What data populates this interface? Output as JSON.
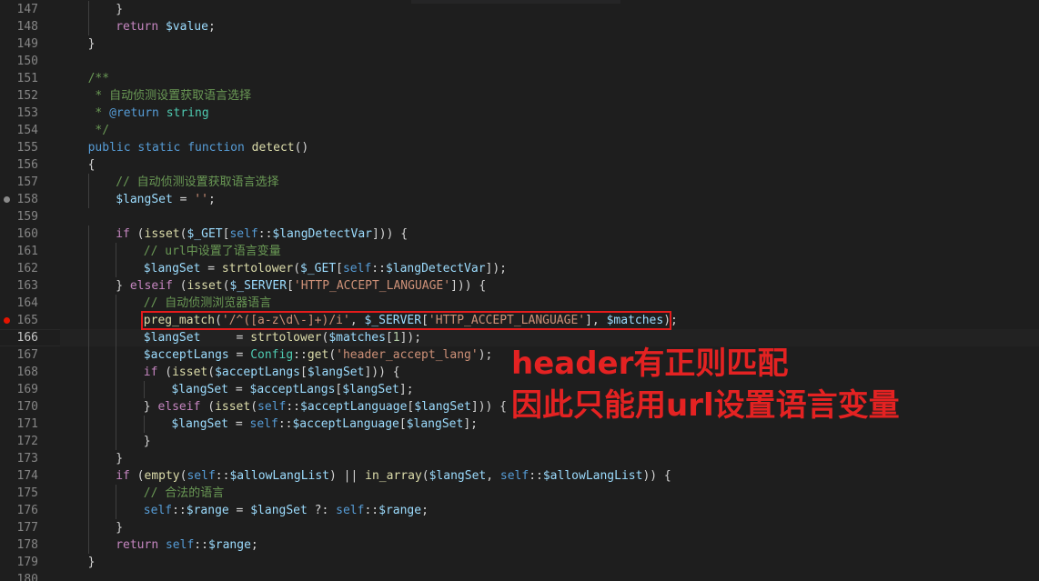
{
  "colors": {
    "background": "#1e1e1e",
    "keyword": "#569cd6",
    "control": "#c586c0",
    "function": "#dcdcaa",
    "variable": "#9cdcfe",
    "string": "#ce9178",
    "comment": "#6a9955",
    "class": "#4ec9b0",
    "text": "#d4d4d4",
    "annotation": "#e42222"
  },
  "editor": {
    "lines": [
      {
        "num": "147",
        "indent": 2,
        "tokens": [
          [
            "}",
            "p"
          ]
        ]
      },
      {
        "num": "148",
        "indent": 2,
        "tokens": [
          [
            "return",
            "c"
          ],
          [
            " ",
            "p"
          ],
          [
            "$value",
            "v"
          ],
          [
            ";",
            "p"
          ]
        ]
      },
      {
        "num": "149",
        "indent": 1,
        "tokens": [
          [
            "}",
            "p"
          ]
        ]
      },
      {
        "num": "150",
        "indent": 0,
        "tokens": []
      },
      {
        "num": "151",
        "indent": 1,
        "tokens": [
          [
            "/**",
            "cm"
          ]
        ]
      },
      {
        "num": "152",
        "indent": 1,
        "tokens": [
          [
            " * 自动侦测设置获取语言选择",
            "cm"
          ]
        ]
      },
      {
        "num": "153",
        "indent": 1,
        "tokens": [
          [
            " * ",
            "cm"
          ],
          [
            "@return",
            "k"
          ],
          [
            " ",
            "cm"
          ],
          [
            "string",
            "ty"
          ]
        ]
      },
      {
        "num": "154",
        "indent": 1,
        "tokens": [
          [
            " */",
            "cm"
          ]
        ]
      },
      {
        "num": "155",
        "indent": 1,
        "tokens": [
          [
            "public",
            "k"
          ],
          [
            " ",
            "p"
          ],
          [
            "static",
            "k"
          ],
          [
            " ",
            "p"
          ],
          [
            "function",
            "k"
          ],
          [
            " ",
            "p"
          ],
          [
            "detect",
            "f"
          ],
          [
            "()",
            "p"
          ]
        ]
      },
      {
        "num": "156",
        "indent": 1,
        "tokens": [
          [
            "{",
            "p"
          ]
        ]
      },
      {
        "num": "157",
        "indent": 2,
        "tokens": [
          [
            "// 自动侦测设置获取语言选择",
            "cm"
          ]
        ]
      },
      {
        "num": "158",
        "indent": 2,
        "bp": "gray",
        "tokens": [
          [
            "$langSet",
            "v"
          ],
          [
            " = ",
            "p"
          ],
          [
            "''",
            "s"
          ],
          [
            ";",
            "p"
          ]
        ]
      },
      {
        "num": "159",
        "indent": 0,
        "tokens": []
      },
      {
        "num": "160",
        "indent": 2,
        "tokens": [
          [
            "if",
            "c"
          ],
          [
            " (",
            "p"
          ],
          [
            "isset",
            "f"
          ],
          [
            "(",
            "p"
          ],
          [
            "$_GET",
            "v"
          ],
          [
            "[",
            "p"
          ],
          [
            "self",
            "k"
          ],
          [
            "::",
            "p"
          ],
          [
            "$langDetectVar",
            "v"
          ],
          [
            "])) {",
            "p"
          ]
        ]
      },
      {
        "num": "161",
        "indent": 3,
        "tokens": [
          [
            "// url中设置了语言变量",
            "cm"
          ]
        ]
      },
      {
        "num": "162",
        "indent": 3,
        "tokens": [
          [
            "$langSet",
            "v"
          ],
          [
            " = ",
            "p"
          ],
          [
            "strtolower",
            "f"
          ],
          [
            "(",
            "p"
          ],
          [
            "$_GET",
            "v"
          ],
          [
            "[",
            "p"
          ],
          [
            "self",
            "k"
          ],
          [
            "::",
            "p"
          ],
          [
            "$langDetectVar",
            "v"
          ],
          [
            "]);",
            "p"
          ]
        ]
      },
      {
        "num": "163",
        "indent": 2,
        "tokens": [
          [
            "} ",
            "p"
          ],
          [
            "elseif",
            "c"
          ],
          [
            " (",
            "p"
          ],
          [
            "isset",
            "f"
          ],
          [
            "(",
            "p"
          ],
          [
            "$_SERVER",
            "v"
          ],
          [
            "[",
            "p"
          ],
          [
            "'HTTP_ACCEPT_LANGUAGE'",
            "s"
          ],
          [
            "])) {",
            "p"
          ]
        ]
      },
      {
        "num": "164",
        "indent": 3,
        "tokens": [
          [
            "// 自动侦测浏览器语言",
            "cm"
          ]
        ]
      },
      {
        "num": "165",
        "indent": 3,
        "bp": "red",
        "tokens": [
          [
            "preg_match",
            "f"
          ],
          [
            "(",
            "p"
          ],
          [
            "'/^(",
            "s"
          ],
          [
            "[a-z\\d\\-]",
            "s"
          ],
          [
            "+)/i'",
            "s"
          ],
          [
            ", ",
            "p"
          ],
          [
            "$_SERVER",
            "v"
          ],
          [
            "[",
            "p"
          ],
          [
            "'HTTP_ACCEPT_LANGUAGE'",
            "s"
          ],
          [
            "], ",
            "p"
          ],
          [
            "$matches",
            "v"
          ],
          [
            ");",
            "p"
          ]
        ]
      },
      {
        "num": "166",
        "indent": 3,
        "current": true,
        "tokens": [
          [
            "$langSet",
            "v"
          ],
          [
            "     = ",
            "p"
          ],
          [
            "strtolower",
            "f"
          ],
          [
            "(",
            "p"
          ],
          [
            "$matches",
            "v"
          ],
          [
            "[",
            "p"
          ],
          [
            "1",
            "n"
          ],
          [
            "]);",
            "p"
          ]
        ]
      },
      {
        "num": "167",
        "indent": 3,
        "tokens": [
          [
            "$acceptLangs",
            "v"
          ],
          [
            " = ",
            "p"
          ],
          [
            "Config",
            "t"
          ],
          [
            "::",
            "p"
          ],
          [
            "get",
            "f"
          ],
          [
            "(",
            "p"
          ],
          [
            "'header_accept_lang'",
            "s"
          ],
          [
            ");",
            "p"
          ]
        ]
      },
      {
        "num": "168",
        "indent": 3,
        "tokens": [
          [
            "if",
            "c"
          ],
          [
            " (",
            "p"
          ],
          [
            "isset",
            "f"
          ],
          [
            "(",
            "p"
          ],
          [
            "$acceptLangs",
            "v"
          ],
          [
            "[",
            "p"
          ],
          [
            "$langSet",
            "v"
          ],
          [
            "])) {",
            "p"
          ]
        ]
      },
      {
        "num": "169",
        "indent": 4,
        "tokens": [
          [
            "$langSet",
            "v"
          ],
          [
            " = ",
            "p"
          ],
          [
            "$acceptLangs",
            "v"
          ],
          [
            "[",
            "p"
          ],
          [
            "$langSet",
            "v"
          ],
          [
            "];",
            "p"
          ]
        ]
      },
      {
        "num": "170",
        "indent": 3,
        "tokens": [
          [
            "} ",
            "p"
          ],
          [
            "elseif",
            "c"
          ],
          [
            " (",
            "p"
          ],
          [
            "isset",
            "f"
          ],
          [
            "(",
            "p"
          ],
          [
            "self",
            "k"
          ],
          [
            "::",
            "p"
          ],
          [
            "$acceptLanguage",
            "v"
          ],
          [
            "[",
            "p"
          ],
          [
            "$langSet",
            "v"
          ],
          [
            "])) {",
            "p"
          ]
        ]
      },
      {
        "num": "171",
        "indent": 4,
        "tokens": [
          [
            "$langSet",
            "v"
          ],
          [
            " = ",
            "p"
          ],
          [
            "self",
            "k"
          ],
          [
            "::",
            "p"
          ],
          [
            "$acceptLanguage",
            "v"
          ],
          [
            "[",
            "p"
          ],
          [
            "$langSet",
            "v"
          ],
          [
            "];",
            "p"
          ]
        ]
      },
      {
        "num": "172",
        "indent": 3,
        "tokens": [
          [
            "}",
            "p"
          ]
        ]
      },
      {
        "num": "173",
        "indent": 2,
        "tokens": [
          [
            "}",
            "p"
          ]
        ]
      },
      {
        "num": "174",
        "indent": 2,
        "tokens": [
          [
            "if",
            "c"
          ],
          [
            " (",
            "p"
          ],
          [
            "empty",
            "f"
          ],
          [
            "(",
            "p"
          ],
          [
            "self",
            "k"
          ],
          [
            "::",
            "p"
          ],
          [
            "$allowLangList",
            "v"
          ],
          [
            ") || ",
            "p"
          ],
          [
            "in_array",
            "f"
          ],
          [
            "(",
            "p"
          ],
          [
            "$langSet",
            "v"
          ],
          [
            ", ",
            "p"
          ],
          [
            "self",
            "k"
          ],
          [
            "::",
            "p"
          ],
          [
            "$allowLangList",
            "v"
          ],
          [
            ")) {",
            "p"
          ]
        ]
      },
      {
        "num": "175",
        "indent": 3,
        "tokens": [
          [
            "// 合法的语言",
            "cm"
          ]
        ]
      },
      {
        "num": "176",
        "indent": 3,
        "tokens": [
          [
            "self",
            "k"
          ],
          [
            "::",
            "p"
          ],
          [
            "$range",
            "v"
          ],
          [
            " = ",
            "p"
          ],
          [
            "$langSet",
            "v"
          ],
          [
            " ?: ",
            "p"
          ],
          [
            "self",
            "k"
          ],
          [
            "::",
            "p"
          ],
          [
            "$range",
            "v"
          ],
          [
            ";",
            "p"
          ]
        ]
      },
      {
        "num": "177",
        "indent": 2,
        "tokens": [
          [
            "}",
            "p"
          ]
        ]
      },
      {
        "num": "178",
        "indent": 2,
        "tokens": [
          [
            "return",
            "c"
          ],
          [
            " ",
            "p"
          ],
          [
            "self",
            "k"
          ],
          [
            "::",
            "p"
          ],
          [
            "$range",
            "v"
          ],
          [
            ";",
            "p"
          ]
        ]
      },
      {
        "num": "179",
        "indent": 1,
        "tokens": [
          [
            "}",
            "p"
          ]
        ]
      },
      {
        "num": "180",
        "indent": 0,
        "tokens": []
      }
    ]
  },
  "annotation": {
    "line1": "header有正则匹配",
    "line2": "因此只能用url设置语言变量"
  }
}
